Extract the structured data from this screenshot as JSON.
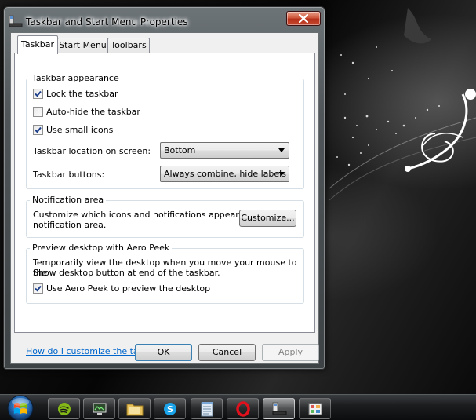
{
  "window": {
    "title": "Taskbar and Start Menu Properties",
    "close_tooltip_icon": "close-icon"
  },
  "tabs": [
    {
      "label": "Taskbar",
      "selected": true
    },
    {
      "label": "Start Menu",
      "selected": false
    },
    {
      "label": "Toolbars",
      "selected": false
    }
  ],
  "appearance": {
    "title": "Taskbar appearance",
    "lock_label": "Lock the taskbar",
    "lock_checked": true,
    "autohide_label": "Auto-hide the taskbar",
    "autohide_checked": false,
    "small_icons_label": "Use small icons",
    "small_icons_checked": true,
    "location_label": "Taskbar location on screen:",
    "location_value": "Bottom",
    "buttons_label": "Taskbar buttons:",
    "buttons_value": "Always combine, hide labels"
  },
  "notification": {
    "title": "Notification area",
    "text_line1": "Customize which icons and notifications appear in the",
    "text_line2": "notification area.",
    "customize_label": "Customize..."
  },
  "peek": {
    "title": "Preview desktop with Aero Peek",
    "text_line1": "Temporarily view the desktop when you move your mouse to the",
    "text_line2": "Show desktop button at end of the taskbar.",
    "use_label": "Use Aero Peek to preview the desktop",
    "use_checked": true
  },
  "help_link": "How do I customize the taskbar?",
  "buttons": {
    "ok": "OK",
    "cancel": "Cancel",
    "apply": "Apply"
  },
  "taskbar": {
    "items": [
      {
        "name": "spotify-icon",
        "active": false
      },
      {
        "name": "monitor-app-icon",
        "active": false
      },
      {
        "name": "folder-icon",
        "active": false
      },
      {
        "name": "skype-icon",
        "active": false
      },
      {
        "name": "notepad-icon",
        "active": false
      },
      {
        "name": "opera-icon",
        "active": false
      },
      {
        "name": "taskbar-properties-icon",
        "active": true
      },
      {
        "name": "control-panel-icon",
        "active": false
      }
    ]
  },
  "colors": {
    "link": "#0066cc",
    "close_button": "#c54a30",
    "default_button_border": "#3c7fb1"
  }
}
